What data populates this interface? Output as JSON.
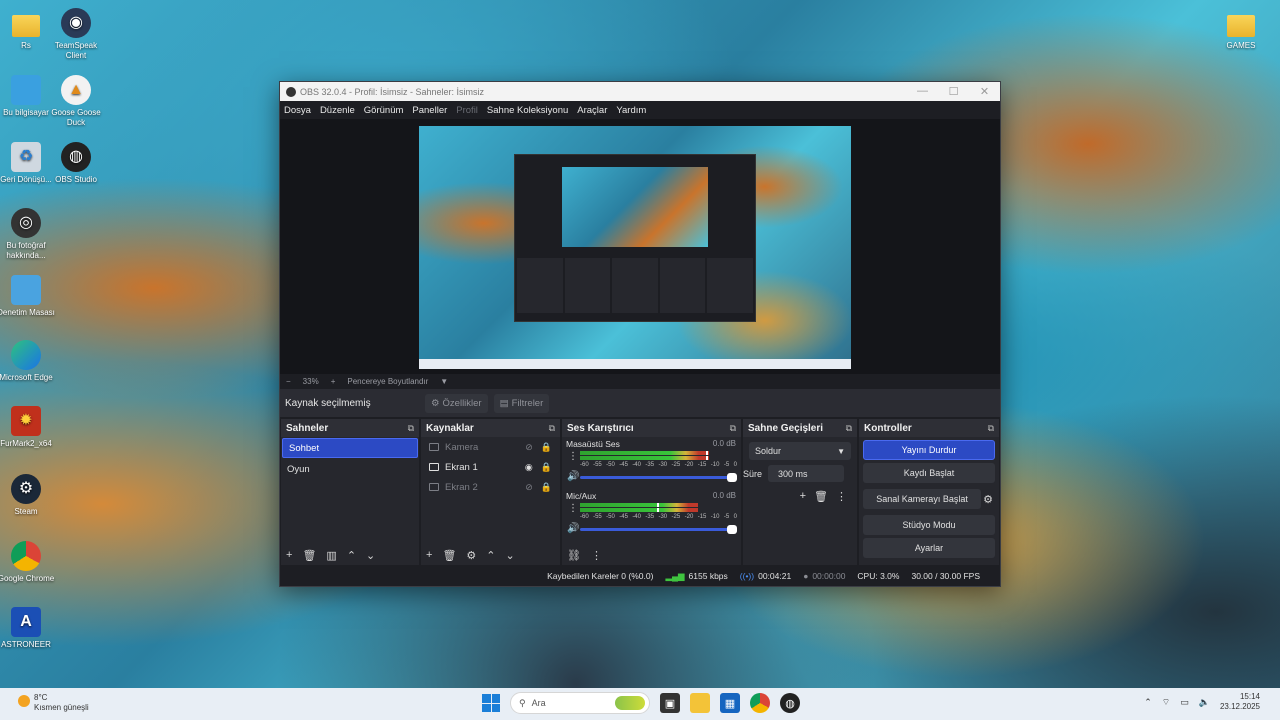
{
  "desktop": {
    "icons_left": [
      {
        "label": "Rs",
        "glyph": "folder-icon"
      },
      {
        "label": "TeamSpeak Client",
        "glyph": "teamspeak-icon"
      },
      {
        "label": "Bu bilgisayar",
        "glyph": "computer-icon"
      },
      {
        "label": "Goose Goose Duck",
        "glyph": "goose-icon"
      },
      {
        "label": "Geri Dönüşü...",
        "glyph": "recycle-bin-icon"
      },
      {
        "label": "OBS Studio",
        "glyph": "obs-icon"
      },
      {
        "label": "Bu fotoğraf hakkında...",
        "glyph": "camera-icon"
      },
      {
        "label": "Denetim Masası",
        "glyph": "control-panel-icon"
      },
      {
        "label": "Microsoft Edge",
        "glyph": "edge-icon"
      },
      {
        "label": "FurMark2_x64",
        "glyph": "furmark-icon"
      },
      {
        "label": "Steam",
        "glyph": "steam-icon"
      },
      {
        "label": "Google Chrome",
        "glyph": "chrome-icon"
      },
      {
        "label": "ASTRONEER",
        "glyph": "astroneer-icon"
      }
    ],
    "icon_right": {
      "label": "GAMES",
      "glyph": "folder-icon"
    }
  },
  "obs": {
    "title": "OBS 32.0.4 - Profil: İsimsiz - Sahneler: İsimsiz",
    "window_controls": [
      "—",
      "☐",
      "✕"
    ],
    "menu": [
      "Dosya",
      "Düzenle",
      "Görünüm",
      "Paneller",
      "Profil",
      "Sahne Koleksiyonu",
      "Araçlar",
      "Yardım"
    ],
    "scale_bar": {
      "zoom_minus": "−",
      "zoom": "33%",
      "zoom_plus": "+",
      "fit": "Pencereye Boyutlandır"
    },
    "properties_bar": {
      "label": "Kaynak seçilmemiş",
      "properties": "Özellikler",
      "filters": "Filtreler"
    },
    "scenes": {
      "title": "Sahneler",
      "items": [
        "Sohbet",
        "Oyun"
      ],
      "selected": "Sohbet"
    },
    "sources": {
      "title": "Kaynaklar",
      "items": [
        {
          "name": "Kamera",
          "visible": false
        },
        {
          "name": "Ekran 1",
          "visible": true
        },
        {
          "name": "Ekran 2",
          "visible": false
        }
      ]
    },
    "mixer": {
      "title": "Ses Karıştırıcı",
      "channels": [
        {
          "name": "Masaüstü Ses",
          "db": "0.0 dB",
          "level": 0.82,
          "peak": 0.8
        },
        {
          "name": "Mic/Aux",
          "db": "0.0 dB",
          "level": 0.75,
          "peak": 0.49
        }
      ],
      "scale": [
        "-60",
        "-55",
        "-50",
        "-45",
        "-40",
        "-35",
        "-30",
        "-25",
        "-20",
        "-15",
        "-10",
        "-5",
        "0"
      ]
    },
    "transitions": {
      "title": "Sahne Geçişleri",
      "selected": "Soldur",
      "duration_label": "Süre",
      "duration_value": "300 ms"
    },
    "controls": {
      "title": "Kontroller",
      "stop_stream": "Yayını Durdur",
      "start_record": "Kaydı Başlat",
      "virtual_cam": "Sanal Kamerayı Başlat",
      "studio_mode": "Stüdyo Modu",
      "settings": "Ayarlar"
    },
    "status": {
      "dropped": "Kaybedilen Kareler 0 (%0.0)",
      "bitrate": "6155 kbps",
      "stream_time": "00:04:21",
      "record_time": "00:00:00",
      "cpu": "CPU: 3.0%",
      "fps": "30.00 / 30.00 FPS"
    }
  },
  "taskbar": {
    "weather_temp": "8°C",
    "weather_desc": "Kısmen güneşli",
    "search_placeholder": "Ara",
    "time": "15:14",
    "date": "23.12.2025"
  }
}
